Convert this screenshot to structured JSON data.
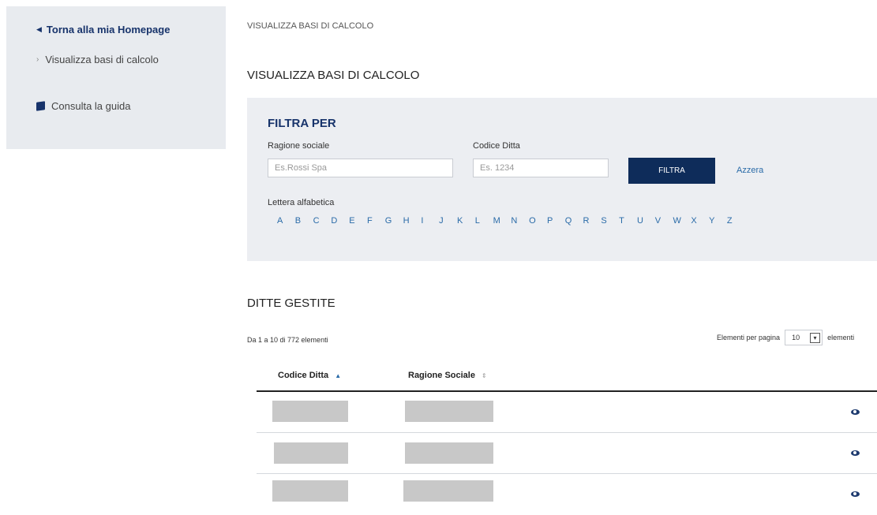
{
  "sidebar": {
    "back_label": "Torna alla mia Homepage",
    "item_label": "Visualizza basi di calcolo",
    "guide_label": "Consulta la guida"
  },
  "breadcrumb": "VISUALIZZA BASI DI CALCOLO",
  "page_title": "VISUALIZZA BASI DI CALCOLO",
  "filter": {
    "title": "FILTRA PER",
    "ragione_label": "Ragione sociale",
    "ragione_placeholder": "Es.Rossi Spa",
    "codice_label": "Codice Ditta",
    "codice_placeholder": "Es. 1234",
    "filtra_button": "FILTRA",
    "azzera_link": "Azzera",
    "alpha_label": "Lettera alfabetica",
    "letters": [
      "A",
      "B",
      "C",
      "D",
      "E",
      "F",
      "G",
      "H",
      "I",
      "J",
      "K",
      "L",
      "M",
      "N",
      "O",
      "P",
      "Q",
      "R",
      "S",
      "T",
      "U",
      "V",
      "W",
      "X",
      "Y",
      "Z"
    ]
  },
  "results": {
    "title": "DITTE GESTITE",
    "count_text": "Da 1 a 10 di 772 elementi",
    "per_page_label": "Elementi per pagina",
    "per_page_value": "10",
    "per_page_suffix": "elementi",
    "columns": [
      "Codice Ditta",
      "Ragione Sociale"
    ]
  },
  "colors": {
    "navy": "#0e2c5a",
    "link_blue": "#2a6ba8",
    "panel_bg": "#eceef2"
  }
}
